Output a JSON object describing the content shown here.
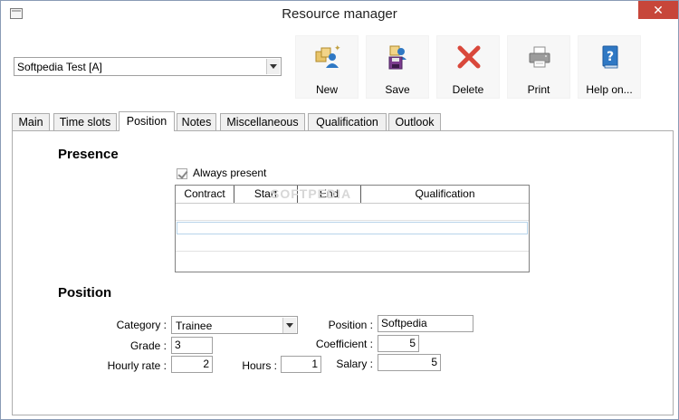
{
  "window": {
    "title": "Resource manager",
    "close_glyph": "✕"
  },
  "resource_select": {
    "value": "Softpedia Test [A]"
  },
  "toolbar": {
    "buttons": [
      {
        "label": "New",
        "icon": "new-resource-icon"
      },
      {
        "label": "Save",
        "icon": "save-icon"
      },
      {
        "label": "Delete",
        "icon": "delete-icon"
      },
      {
        "label": "Print",
        "icon": "print-icon"
      },
      {
        "label": "Help on...",
        "icon": "help-book-icon"
      }
    ]
  },
  "tabs": [
    {
      "label": "Main"
    },
    {
      "label": "Time slots"
    },
    {
      "label": "Position",
      "active": true
    },
    {
      "label": "Notes"
    },
    {
      "label": "Miscellaneous"
    },
    {
      "label": "Qualification"
    },
    {
      "label": "Outlook"
    }
  ],
  "presence": {
    "title": "Presence",
    "always_present_label": "Always present",
    "always_present_checked": true,
    "columns": [
      "Contract",
      "Start",
      "End",
      "Qualification"
    ],
    "rows": [],
    "watermark": "SOFTPEDIA"
  },
  "position": {
    "title": "Position",
    "category_label": "Category :",
    "category_value": "Trainee",
    "grade_label": "Grade :",
    "grade_value": "3",
    "hourly_rate_label": "Hourly rate :",
    "hourly_rate_value": "2",
    "hours_label": "Hours :",
    "hours_value": "1",
    "position_label": "Position :",
    "position_value": "Softpedia",
    "coefficient_label": "Coefficient :",
    "coefficient_value": "5",
    "salary_label": "Salary :",
    "salary_value": "5"
  },
  "colors": {
    "close_button": "#c7463a",
    "delete_icon": "#d9483b",
    "icon_blue": "#2f78c4",
    "selection_border": "#b7d4ea"
  }
}
